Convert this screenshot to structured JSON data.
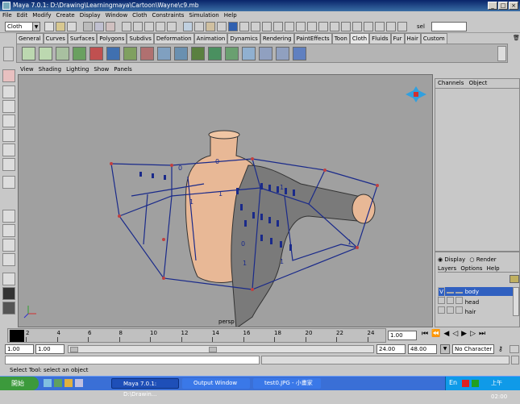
{
  "window": {
    "title": "Maya 7.0.1: D:\\Drawing\\Learningmaya\\Cartoon\\Wayne\\c9.mb"
  },
  "menubar": {
    "items": [
      "File",
      "Edit",
      "Modify",
      "Create",
      "Display",
      "Window",
      "Cloth",
      "Constraints",
      "Simulation",
      "Help"
    ]
  },
  "statusline": {
    "menuset": "Cloth",
    "sel_label": "sel",
    "colors": {
      "accent": "#0a246a",
      "viewport": "#a0a0a0"
    }
  },
  "shelf_tabs": [
    "General",
    "Curves",
    "Surfaces",
    "Polygons",
    "Subdivs",
    "Deformation",
    "Animation",
    "Dynamics",
    "Rendering",
    "PaintEffects",
    "Toon",
    "Cloth",
    "Fluids",
    "Fur",
    "Hair",
    "Custom"
  ],
  "shelf_active": "Cloth",
  "viewport": {
    "menu": [
      "View",
      "Shading",
      "Lighting",
      "Show",
      "Panels"
    ],
    "camera_label": "persp",
    "labels": {
      "n0a": "0",
      "n0b": "0",
      "n0c": "0",
      "n1a": "1",
      "n1b": "1",
      "n1c": "1",
      "n1d": "1",
      "n1e": "1",
      "n1f": "1"
    }
  },
  "channel_box": {
    "tabs": [
      "Channels",
      "Object"
    ]
  },
  "layer_editor": {
    "modes": [
      "Display",
      "Render"
    ],
    "menu": [
      "Layers",
      "Options",
      "Help"
    ],
    "layers": [
      {
        "visible": "V",
        "name": "body",
        "selected": true
      },
      {
        "visible": "",
        "name": "head",
        "selected": false
      },
      {
        "visible": "",
        "name": "hair",
        "selected": false
      }
    ]
  },
  "timeline": {
    "ticks": [
      "2",
      "4",
      "6",
      "8",
      "10",
      "12",
      "14",
      "16",
      "18",
      "20",
      "22",
      "24"
    ],
    "current_frame": "1.00"
  },
  "range": {
    "start": "1.00",
    "start_inner": "1.00",
    "end_inner": "24.00",
    "end": "48.00",
    "character_set": "No Character Set"
  },
  "helpline": {
    "text": "Select Tool: select an object"
  },
  "taskbar": {
    "start": "開始",
    "tasks": [
      "Maya 7.0.1: D:\\Drawin...",
      "Output Window",
      "test0.JPG - 小畫家"
    ],
    "clock": "上午 02:00"
  }
}
